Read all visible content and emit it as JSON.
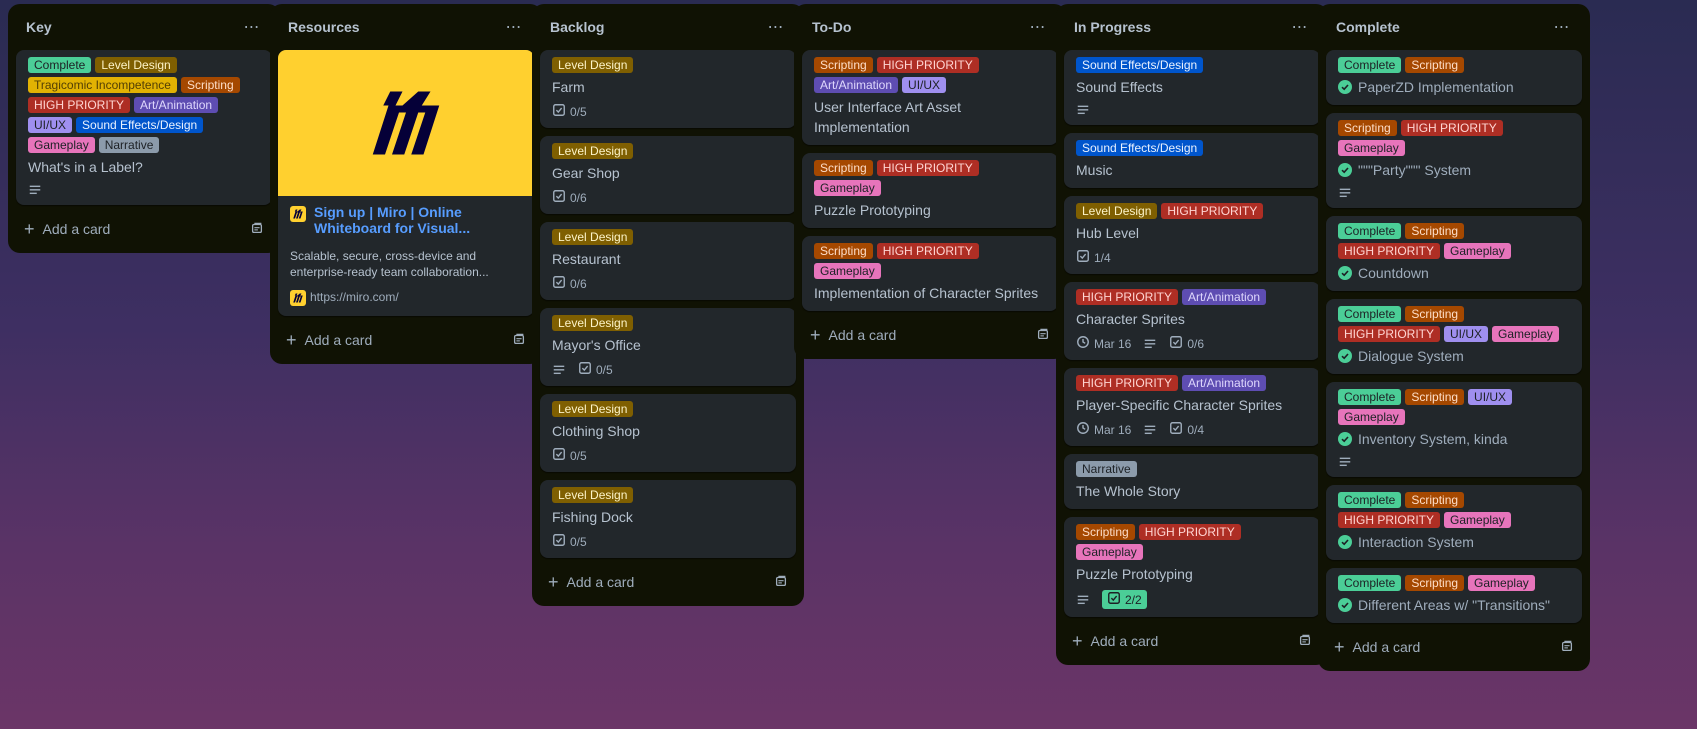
{
  "lists": [
    {
      "title": "Key",
      "cards": [
        {
          "labels": [
            {
              "text": "Complete",
              "cls": "l-complete"
            },
            {
              "text": "Level Design",
              "cls": "l-level"
            },
            {
              "text": "Tragicomic Incompetence",
              "cls": "l-tragi"
            },
            {
              "text": "Scripting",
              "cls": "l-scripting"
            },
            {
              "text": "HIGH PRIORITY",
              "cls": "l-high"
            },
            {
              "text": "Art/Animation",
              "cls": "l-art"
            },
            {
              "text": "UI/UX",
              "cls": "l-uiux"
            },
            {
              "text": "Sound Effects/Design",
              "cls": "l-sound"
            },
            {
              "text": "Gameplay",
              "cls": "l-gameplay"
            },
            {
              "text": "Narrative",
              "cls": "l-narrative"
            }
          ],
          "title": "What's in a Label?",
          "description": true
        }
      ],
      "add_label": "Add a card"
    },
    {
      "title": "Resources",
      "link_card": {
        "title": "Sign up | Miro | Online Whiteboard for Visual...",
        "description": "Scalable, secure, cross-device and enterprise-ready team collaboration...",
        "url": "https://miro.com/"
      },
      "add_label": "Add a card"
    },
    {
      "title": "Backlog",
      "cards": [
        {
          "labels": [
            {
              "text": "Level Design",
              "cls": "l-level"
            }
          ],
          "title": "Farm",
          "checklist": "0/5"
        },
        {
          "labels": [
            {
              "text": "Level Design",
              "cls": "l-level"
            }
          ],
          "title": "Gear Shop",
          "checklist": "0/6"
        },
        {
          "labels": [
            {
              "text": "Level Design",
              "cls": "l-level"
            }
          ],
          "title": "Restaurant",
          "checklist": "0/6"
        },
        {
          "labels": [
            {
              "text": "Level Design",
              "cls": "l-level"
            }
          ],
          "title": "Mayor's Office",
          "description": true,
          "checklist": "0/5"
        },
        {
          "labels": [
            {
              "text": "Level Design",
              "cls": "l-level"
            }
          ],
          "title": "Clothing Shop",
          "checklist": "0/5"
        },
        {
          "labels": [
            {
              "text": "Level Design",
              "cls": "l-level"
            }
          ],
          "title": "Fishing Dock",
          "checklist": "0/5"
        }
      ],
      "add_label": "Add a card"
    },
    {
      "title": "To-Do",
      "cards": [
        {
          "labels": [
            {
              "text": "Scripting",
              "cls": "l-scripting"
            },
            {
              "text": "HIGH PRIORITY",
              "cls": "l-high"
            },
            {
              "text": "Art/Animation",
              "cls": "l-art"
            },
            {
              "text": "UI/UX",
              "cls": "l-uiux"
            }
          ],
          "title": "User Interface Art Asset Implementation"
        },
        {
          "labels": [
            {
              "text": "Scripting",
              "cls": "l-scripting"
            },
            {
              "text": "HIGH PRIORITY",
              "cls": "l-high"
            },
            {
              "text": "Gameplay",
              "cls": "l-gameplay"
            }
          ],
          "title": "Puzzle Prototyping"
        },
        {
          "labels": [
            {
              "text": "Scripting",
              "cls": "l-scripting"
            },
            {
              "text": "HIGH PRIORITY",
              "cls": "l-high"
            },
            {
              "text": "Gameplay",
              "cls": "l-gameplay"
            }
          ],
          "title": "Implementation of Character Sprites"
        }
      ],
      "add_label": "Add a card"
    },
    {
      "title": "In Progress",
      "cards": [
        {
          "labels": [
            {
              "text": "Sound Effects/Design",
              "cls": "l-sound"
            }
          ],
          "title": "Sound Effects",
          "description": true
        },
        {
          "labels": [
            {
              "text": "Sound Effects/Design",
              "cls": "l-sound"
            }
          ],
          "title": "Music"
        },
        {
          "labels": [
            {
              "text": "Level Design",
              "cls": "l-level"
            },
            {
              "text": "HIGH PRIORITY",
              "cls": "l-high"
            }
          ],
          "title": "Hub Level",
          "checklist": "1/4"
        },
        {
          "labels": [
            {
              "text": "HIGH PRIORITY",
              "cls": "l-high"
            },
            {
              "text": "Art/Animation",
              "cls": "l-art"
            }
          ],
          "title": "Character Sprites",
          "date": "Mar 16",
          "description": true,
          "checklist": "0/6"
        },
        {
          "labels": [
            {
              "text": "HIGH PRIORITY",
              "cls": "l-high"
            },
            {
              "text": "Art/Animation",
              "cls": "l-art"
            }
          ],
          "title": "Player-Specific Character Sprites",
          "date": "Mar 16",
          "description": true,
          "checklist": "0/4"
        },
        {
          "labels": [
            {
              "text": "Narrative",
              "cls": "l-narrative"
            }
          ],
          "title": "The Whole Story"
        },
        {
          "labels": [
            {
              "text": "Scripting",
              "cls": "l-scripting"
            },
            {
              "text": "HIGH PRIORITY",
              "cls": "l-high"
            },
            {
              "text": "Gameplay",
              "cls": "l-gameplay"
            }
          ],
          "title": "Puzzle Prototyping",
          "description": true,
          "checklist_done": "2/2"
        }
      ],
      "add_label": "Add a card"
    },
    {
      "title": "Complete",
      "cards": [
        {
          "labels": [
            {
              "text": "Complete",
              "cls": "l-complete"
            },
            {
              "text": "Scripting",
              "cls": "l-scripting"
            }
          ],
          "title": "PaperZD Implementation",
          "done": true
        },
        {
          "labels": [
            {
              "text": "Scripting",
              "cls": "l-scripting"
            },
            {
              "text": "HIGH PRIORITY",
              "cls": "l-high"
            },
            {
              "text": "Gameplay",
              "cls": "l-gameplay"
            }
          ],
          "title": "\"\"\"Party\"\"\" System",
          "done": true,
          "description": true
        },
        {
          "labels": [
            {
              "text": "Complete",
              "cls": "l-complete"
            },
            {
              "text": "Scripting",
              "cls": "l-scripting"
            },
            {
              "text": "HIGH PRIORITY",
              "cls": "l-high"
            },
            {
              "text": "Gameplay",
              "cls": "l-gameplay"
            }
          ],
          "title": "Countdown",
          "done": true
        },
        {
          "labels": [
            {
              "text": "Complete",
              "cls": "l-complete"
            },
            {
              "text": "Scripting",
              "cls": "l-scripting"
            },
            {
              "text": "HIGH PRIORITY",
              "cls": "l-high"
            },
            {
              "text": "UI/UX",
              "cls": "l-uiux"
            },
            {
              "text": "Gameplay",
              "cls": "l-gameplay"
            }
          ],
          "title": "Dialogue System",
          "done": true
        },
        {
          "labels": [
            {
              "text": "Complete",
              "cls": "l-complete"
            },
            {
              "text": "Scripting",
              "cls": "l-scripting"
            },
            {
              "text": "UI/UX",
              "cls": "l-uiux"
            },
            {
              "text": "Gameplay",
              "cls": "l-gameplay"
            }
          ],
          "title": "Inventory System, kinda",
          "done": true,
          "description": true
        },
        {
          "labels": [
            {
              "text": "Complete",
              "cls": "l-complete"
            },
            {
              "text": "Scripting",
              "cls": "l-scripting"
            },
            {
              "text": "HIGH PRIORITY",
              "cls": "l-high"
            },
            {
              "text": "Gameplay",
              "cls": "l-gameplay"
            }
          ],
          "title": "Interaction System",
          "done": true
        },
        {
          "labels": [
            {
              "text": "Complete",
              "cls": "l-complete"
            },
            {
              "text": "Scripting",
              "cls": "l-scripting"
            },
            {
              "text": "Gameplay",
              "cls": "l-gameplay"
            }
          ],
          "title": "Different Areas w/ \"Transitions\"",
          "done": true
        }
      ],
      "add_label": "Add a card"
    }
  ],
  "icons": {
    "list_menu": "more-horizontal-icon",
    "add": "plus-icon",
    "template": "card-template-icon",
    "description": "description-icon",
    "checklist": "checklist-icon",
    "due_date": "clock-icon",
    "complete": "check-circle-icon",
    "miro": "miro-logo"
  }
}
